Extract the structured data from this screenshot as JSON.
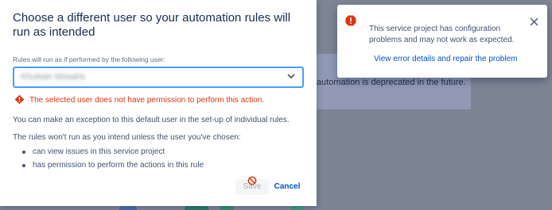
{
  "background": {
    "notice_text": "automation is deprecated in the future."
  },
  "modal": {
    "title": "Choose a different user so your automation rules will run as intended",
    "field_label": "Rules will run as if performed by the following user:",
    "selected_user": "Khulsan Mosahs",
    "error_text": "The selected user does not have permission to perform this action.",
    "exception_text": "You can make an exception to this default user in the set-up of individual rules.",
    "rules_text": "The rules won't run as you intend unless the user you've chosen:",
    "requirements": [
      "can view issues in this service project",
      "has permission to perform the actions in this rule"
    ],
    "save_label": "Save",
    "cancel_label": "Cancel"
  },
  "flag": {
    "message": "This service project has configuration problems and may not work as expected.",
    "link_text": "View error details and repair the problem"
  },
  "colors": {
    "accent": "#0052cc",
    "error": "#de350b",
    "focus_border": "#4c9aff",
    "overlay": "#7d8494"
  }
}
